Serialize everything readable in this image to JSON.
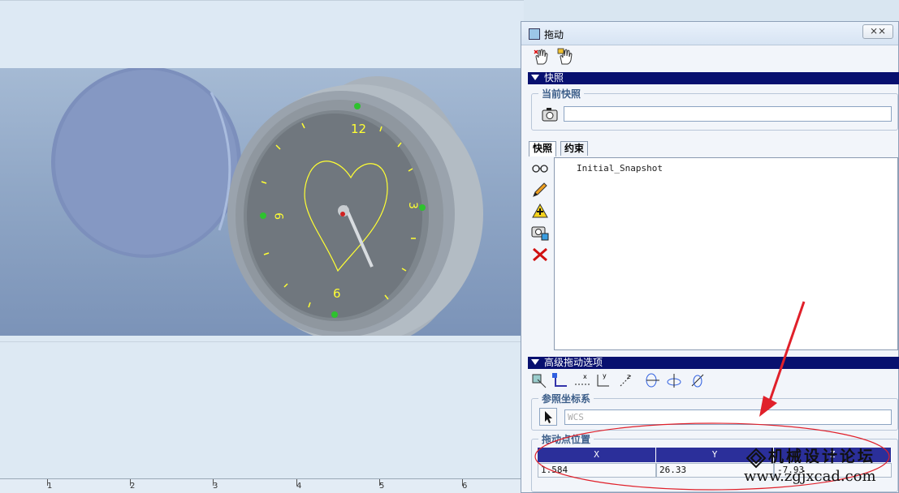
{
  "dialog": {
    "title": "拖动",
    "close_label": "⨯⨯",
    "snapshots_section": "快照",
    "current_snapshot_label": "当前快照",
    "current_snapshot_value": "",
    "tabs": [
      "快照",
      "约束"
    ],
    "snapshot_list": [
      "Initial_Snapshot"
    ],
    "advanced_section": "高级拖动选项",
    "ref_coord_label": "参照坐标系",
    "ref_coord_value": "WCS",
    "drag_point_label": "拖动点位置",
    "columns": [
      "X",
      "Y",
      "Z"
    ],
    "values": [
      "1.584",
      "26.33",
      "-7.93"
    ]
  },
  "ruler": {
    "labels": [
      "1",
      "2",
      "3",
      "4",
      "5",
      "6"
    ]
  },
  "clock_numbers": {
    "twelve": "12",
    "three": "3",
    "six": "6",
    "nine": "9"
  },
  "watermark": {
    "line1": "机械设计论坛",
    "line2": "www.zgjxcad.com"
  },
  "colors": {
    "section_bar": "#08106f",
    "grid_header": "#2b2f9a",
    "annotation": "#e0202a",
    "clock_marks": "#ffff33"
  }
}
